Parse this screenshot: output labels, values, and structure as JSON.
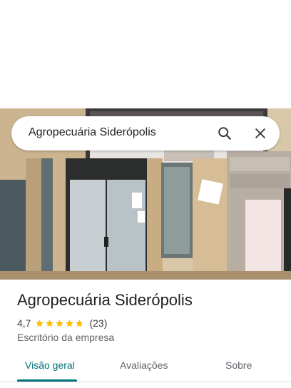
{
  "search": {
    "query": "Agropecuária Siderópolis",
    "search_icon": "search-icon",
    "close_icon": "close-icon"
  },
  "place": {
    "title": "Agropecuária Siderópolis",
    "rating": "4,7",
    "rating_value": 4.7,
    "rating_max": 5,
    "review_count": "(23)",
    "category": "Escritório da empresa"
  },
  "tabs": [
    {
      "label": "Visão geral",
      "active": true
    },
    {
      "label": "Avaliações",
      "active": false
    },
    {
      "label": "Sobre",
      "active": false
    }
  ],
  "colors": {
    "accent": "#00737a",
    "star": "#fbbc04",
    "text_primary": "#202124",
    "text_secondary": "#5f6368"
  }
}
